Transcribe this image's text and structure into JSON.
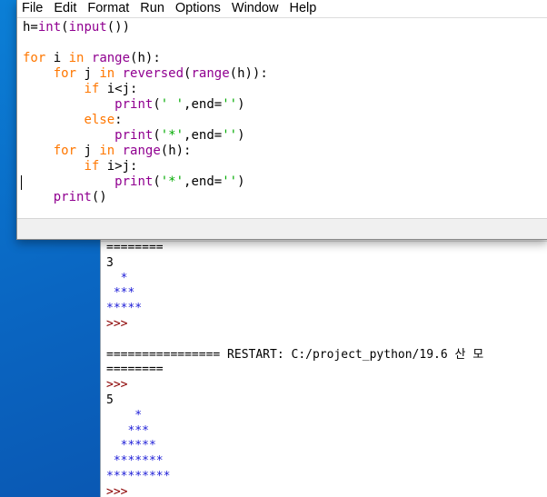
{
  "menu": [
    "File",
    "Edit",
    "Format",
    "Run",
    "Options",
    "Window",
    "Help"
  ],
  "editor_code": [
    [
      {
        "t": "h=",
        "c": "df"
      },
      {
        "t": "int",
        "c": "bi"
      },
      {
        "t": "(",
        "c": "df"
      },
      {
        "t": "input",
        "c": "bi"
      },
      {
        "t": "())",
        "c": "df"
      }
    ],
    [],
    [
      {
        "t": "for",
        "c": "kw"
      },
      {
        "t": " i ",
        "c": "df"
      },
      {
        "t": "in",
        "c": "kw"
      },
      {
        "t": " ",
        "c": "df"
      },
      {
        "t": "range",
        "c": "bi"
      },
      {
        "t": "(h):",
        "c": "df"
      }
    ],
    [
      {
        "t": "    ",
        "c": "df"
      },
      {
        "t": "for",
        "c": "kw"
      },
      {
        "t": " j ",
        "c": "df"
      },
      {
        "t": "in",
        "c": "kw"
      },
      {
        "t": " ",
        "c": "df"
      },
      {
        "t": "reversed",
        "c": "bi"
      },
      {
        "t": "(",
        "c": "df"
      },
      {
        "t": "range",
        "c": "bi"
      },
      {
        "t": "(h)):",
        "c": "df"
      }
    ],
    [
      {
        "t": "        ",
        "c": "df"
      },
      {
        "t": "if",
        "c": "kw"
      },
      {
        "t": " i<j:",
        "c": "df"
      }
    ],
    [
      {
        "t": "            ",
        "c": "df"
      },
      {
        "t": "print",
        "c": "bi"
      },
      {
        "t": "(",
        "c": "df"
      },
      {
        "t": "' '",
        "c": "st"
      },
      {
        "t": ",end=",
        "c": "df"
      },
      {
        "t": "''",
        "c": "st"
      },
      {
        "t": ")",
        "c": "df"
      }
    ],
    [
      {
        "t": "        ",
        "c": "df"
      },
      {
        "t": "else",
        "c": "kw"
      },
      {
        "t": ":",
        "c": "df"
      }
    ],
    [
      {
        "t": "            ",
        "c": "df"
      },
      {
        "t": "print",
        "c": "bi"
      },
      {
        "t": "(",
        "c": "df"
      },
      {
        "t": "'*'",
        "c": "st"
      },
      {
        "t": ",end=",
        "c": "df"
      },
      {
        "t": "''",
        "c": "st"
      },
      {
        "t": ")",
        "c": "df"
      }
    ],
    [
      {
        "t": "    ",
        "c": "df"
      },
      {
        "t": "for",
        "c": "kw"
      },
      {
        "t": " j ",
        "c": "df"
      },
      {
        "t": "in",
        "c": "kw"
      },
      {
        "t": " ",
        "c": "df"
      },
      {
        "t": "range",
        "c": "bi"
      },
      {
        "t": "(h):",
        "c": "df"
      }
    ],
    [
      {
        "t": "        ",
        "c": "df"
      },
      {
        "t": "if",
        "c": "kw"
      },
      {
        "t": " i>j:",
        "c": "df"
      }
    ],
    [
      {
        "t": "            ",
        "c": "df"
      },
      {
        "t": "print",
        "c": "bi"
      },
      {
        "t": "(",
        "c": "df"
      },
      {
        "t": "'*'",
        "c": "st"
      },
      {
        "t": ",end=",
        "c": "df"
      },
      {
        "t": "''",
        "c": "st"
      },
      {
        "t": ")",
        "c": "df"
      }
    ],
    [
      {
        "t": "    ",
        "c": "df"
      },
      {
        "t": "print",
        "c": "bi"
      },
      {
        "t": "()",
        "c": "df"
      }
    ]
  ],
  "shell_lines": [
    {
      "text": "========",
      "color": "black"
    },
    {
      "text": "3",
      "color": "black"
    },
    {
      "text": "  *",
      "color": "blue"
    },
    {
      "text": " ***",
      "color": "blue"
    },
    {
      "text": "*****",
      "color": "blue"
    },
    {
      "text": ">>>",
      "color": "red"
    },
    {
      "text": "",
      "color": "black"
    },
    {
      "text": "================ RESTART: C:/project_python/19.6 산 모",
      "color": "black"
    },
    {
      "text": "========",
      "color": "black"
    },
    {
      "text": ">>>",
      "color": "red"
    },
    {
      "text": "5",
      "color": "black"
    },
    {
      "text": "    *",
      "color": "blue"
    },
    {
      "text": "   ***",
      "color": "blue"
    },
    {
      "text": "  *****",
      "color": "blue"
    },
    {
      "text": " *******",
      "color": "blue"
    },
    {
      "text": "*********",
      "color": "blue"
    },
    {
      "text": ">>>",
      "color": "red"
    }
  ]
}
